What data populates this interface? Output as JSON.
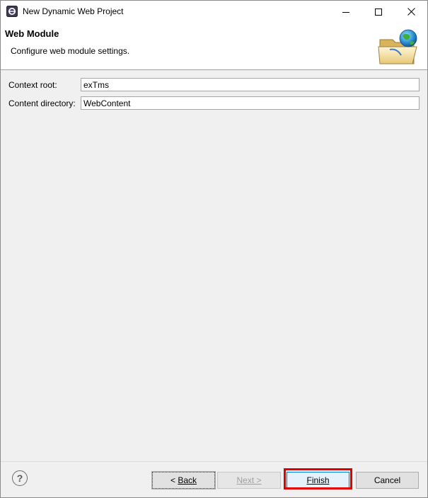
{
  "window": {
    "title": "New Dynamic Web Project",
    "controls": {
      "minimize": "minimize",
      "maximize": "maximize",
      "close": "close"
    }
  },
  "banner": {
    "title": "Web Module",
    "description": "Configure web module settings.",
    "icon": "web-project-folder-globe-icon"
  },
  "form": {
    "context_root_label": "Context root:",
    "context_root_value": "exTms",
    "content_dir_label": "Content directory:",
    "content_dir_value": "WebContent"
  },
  "buttons": {
    "help": "?",
    "back_prefix": "< ",
    "back_label": "Back",
    "next_label": "Next >",
    "finish_label": "Finish",
    "cancel_label": "Cancel"
  },
  "colors": {
    "highlight": "#e00000",
    "finish_border": "#0078d7"
  }
}
